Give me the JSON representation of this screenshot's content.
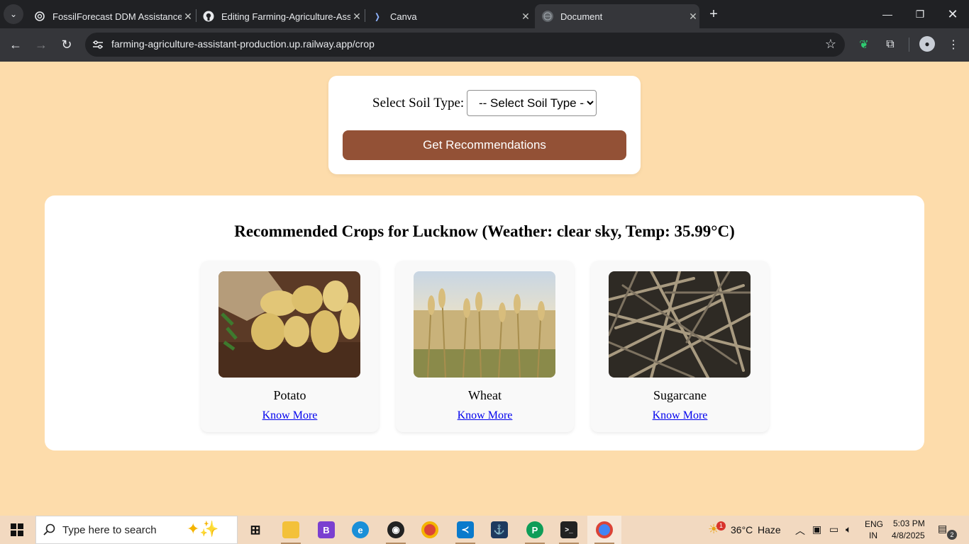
{
  "browser": {
    "tabs": [
      {
        "title": "FossilForecast DDM Assistance",
        "icon": "openai-icon"
      },
      {
        "title": "Editing Farming-Agriculture-Assistant",
        "icon": "github-icon"
      },
      {
        "title": "Canva",
        "icon": "canva-icon"
      },
      {
        "title": "Document",
        "icon": "globe-icon",
        "active": true
      }
    ],
    "url": "farming-agriculture-assistant-production.up.railway.app/crop"
  },
  "soil_form": {
    "label": "Select Soil Type:",
    "selected": "-- Select Soil Type --",
    "button": "Get Recommendations"
  },
  "results": {
    "title": "Recommended Crops for Lucknow (Weather: clear sky, Temp: 35.99°C)",
    "crops": [
      {
        "name": "Potato",
        "link": "Know More"
      },
      {
        "name": "Wheat",
        "link": "Know More"
      },
      {
        "name": "Sugarcane",
        "link": "Know More"
      }
    ]
  },
  "taskbar": {
    "search_placeholder": "Type here to search",
    "weather_temp": "36°C",
    "weather_desc": "Haze",
    "weather_alert": "1",
    "lang": "ENG",
    "region": "IN",
    "time": "5:03 PM",
    "date": "4/8/2025",
    "notifications": "2"
  },
  "colors": {
    "page_bg": "#fddcab",
    "button": "#935136",
    "link": "#0000ee"
  }
}
